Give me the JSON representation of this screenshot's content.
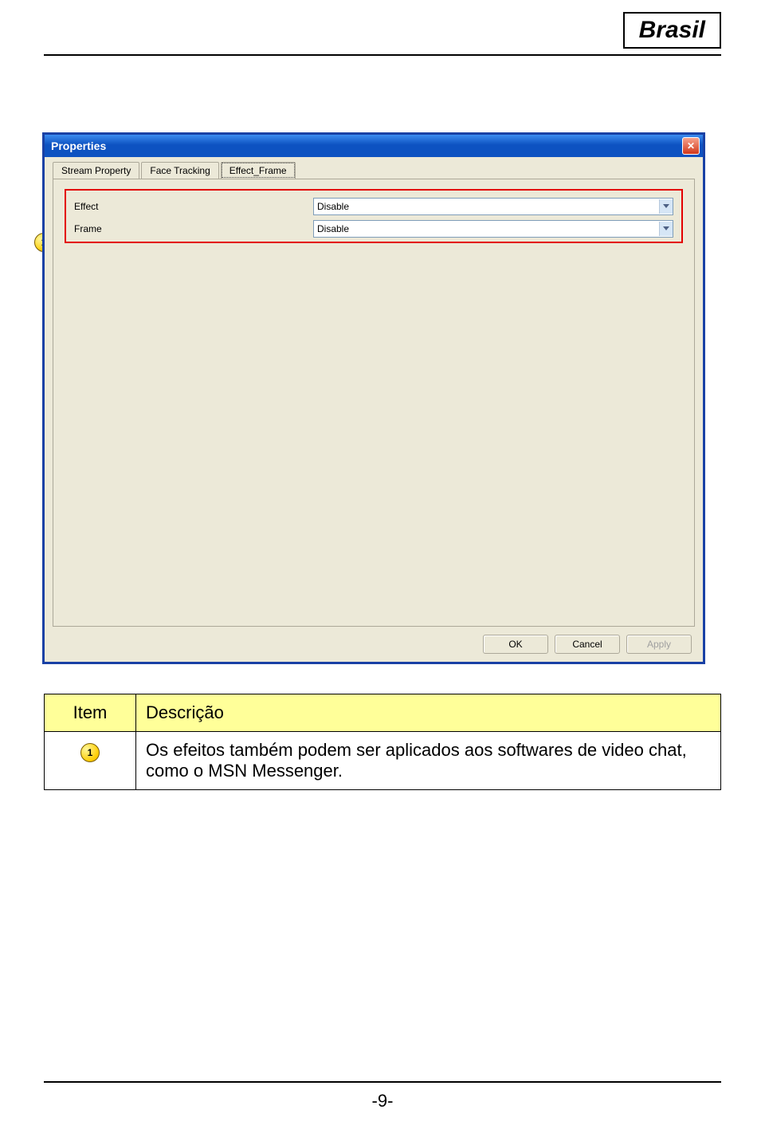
{
  "header": {
    "region": "Brasil"
  },
  "dialog": {
    "title": "Properties",
    "tabs": [
      "Stream Property",
      "Face Tracking",
      "Effect_Frame"
    ],
    "active_tab_index": 2,
    "fields": {
      "effect": {
        "label": "Effect",
        "value": "Disable"
      },
      "frame": {
        "label": "Frame",
        "value": "Disable"
      }
    },
    "buttons": {
      "ok": "OK",
      "cancel": "Cancel",
      "apply": "Apply"
    }
  },
  "callout": {
    "number": "1"
  },
  "table": {
    "head_item": "Item",
    "head_desc": "Descrição",
    "row1_badge": "1",
    "row1_desc": "Os efeitos também podem ser aplicados  aos softwares de video chat, como o MSN Messenger."
  },
  "footer": {
    "page": "-9-"
  }
}
